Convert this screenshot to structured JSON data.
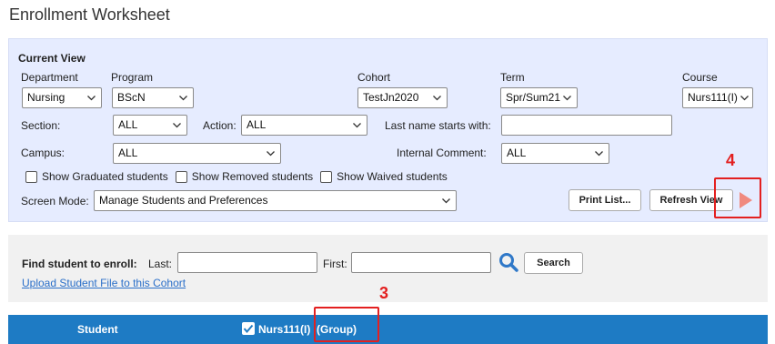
{
  "page": {
    "title": "Enrollment Worksheet"
  },
  "current_view": {
    "title": "Current View",
    "department": {
      "label": "Department",
      "value": "Nursing"
    },
    "program": {
      "label": "Program",
      "value": "BScN"
    },
    "cohort": {
      "label": "Cohort",
      "value": "TestJn2020"
    },
    "term": {
      "label": "Term",
      "value": "Spr/Sum21"
    },
    "course": {
      "label": "Course",
      "value": "Nurs111(I)"
    },
    "section": {
      "label": "Section:",
      "value": "ALL"
    },
    "action": {
      "label": "Action:",
      "value": "ALL"
    },
    "last_name": {
      "label": "Last name starts with:",
      "value": ""
    },
    "campus": {
      "label": "Campus:",
      "value": "ALL"
    },
    "internal_comment": {
      "label": "Internal Comment:",
      "value": "ALL"
    },
    "checkboxes": {
      "graduated": "Show Graduated students",
      "removed": "Show Removed students",
      "waived": "Show Waived students"
    },
    "screen_mode": {
      "label": "Screen Mode:",
      "value": "Manage Students and Preferences"
    },
    "print_button": "Print List...",
    "refresh_button": "Refresh View"
  },
  "find": {
    "label": "Find student to enroll:",
    "last_label": "Last:",
    "last_value": "",
    "first_label": "First:",
    "first_value": "",
    "search_button": "Search",
    "upload_link": "Upload Student File to this Cohort"
  },
  "annotations": {
    "callout_3": "3",
    "callout_4": "4",
    "color": "#e32020"
  },
  "table_header": {
    "student": "Student",
    "course_column": "Nurs111(I)  (Group)",
    "header_color": "#1e7bc4"
  },
  "icons": {
    "search": "magnifier-icon",
    "play": "play-icon",
    "dropdown": "chevron-down-icon"
  }
}
